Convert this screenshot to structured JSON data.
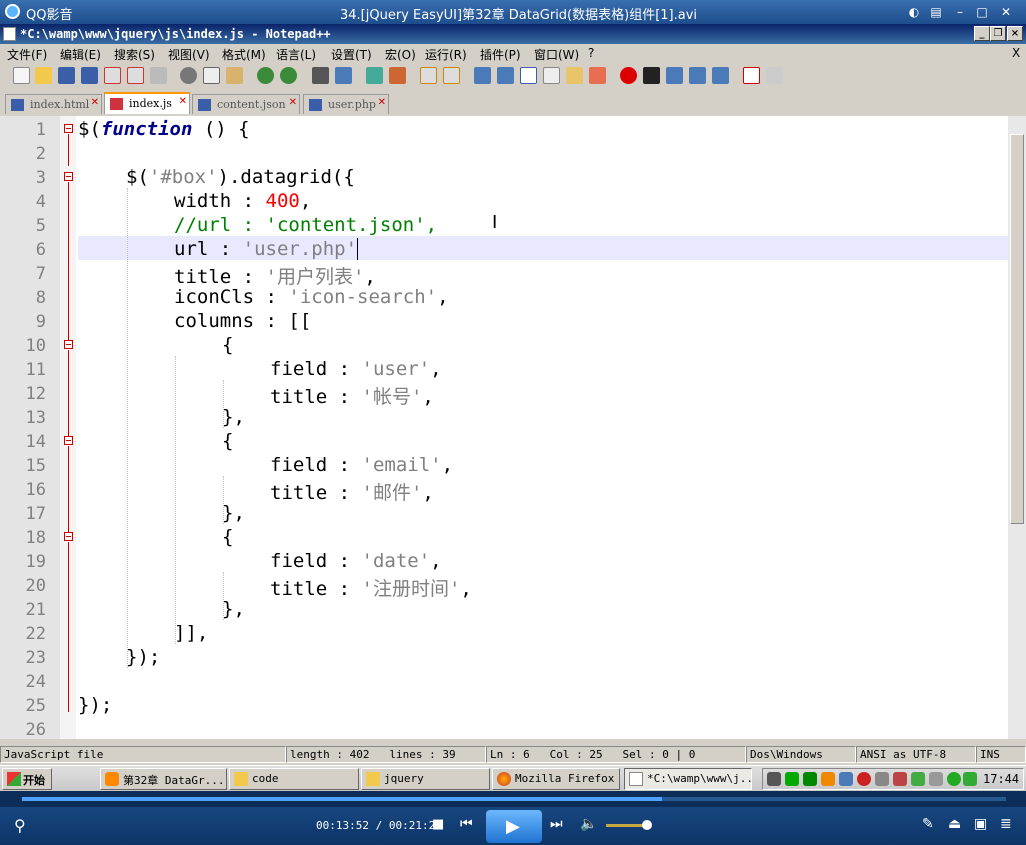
{
  "player": {
    "app_name": "QQ影音",
    "video_title": "34.[jQuery EasyUI]第32章 DataGrid(数据表格)组件[1].avi",
    "time_current": "00:13:52",
    "time_total": "00:21:21",
    "time_display": "00:13:52 / 00:21:21",
    "progress": 0.65,
    "volume": 0.6
  },
  "editor_window": {
    "title": "*C:\\wamp\\www\\jquery\\js\\index.js - Notepad++",
    "menu": [
      "文件(F)",
      "编辑(E)",
      "搜索(S)",
      "视图(V)",
      "格式(M)",
      "语言(L)",
      "设置(T)",
      "宏(O)",
      "运行(R)",
      "插件(P)",
      "窗口(W)",
      "?"
    ],
    "close_x": "X",
    "tabs": [
      {
        "label": "index.html",
        "active": false
      },
      {
        "label": "index.js",
        "active": true
      },
      {
        "label": "content.json",
        "active": false
      },
      {
        "label": "user.php",
        "active": false
      }
    ],
    "lines": [
      {
        "n": "1"
      },
      {
        "n": "2"
      },
      {
        "n": "3"
      },
      {
        "n": "4"
      },
      {
        "n": "5"
      },
      {
        "n": "6"
      },
      {
        "n": "7"
      },
      {
        "n": "8"
      },
      {
        "n": "9"
      },
      {
        "n": "10"
      },
      {
        "n": "11"
      },
      {
        "n": "12"
      },
      {
        "n": "13"
      },
      {
        "n": "14"
      },
      {
        "n": "15"
      },
      {
        "n": "16"
      },
      {
        "n": "17"
      },
      {
        "n": "18"
      },
      {
        "n": "19"
      },
      {
        "n": "20"
      },
      {
        "n": "21"
      },
      {
        "n": "22"
      },
      {
        "n": "23"
      },
      {
        "n": "24"
      },
      {
        "n": "25"
      },
      {
        "n": "26"
      }
    ],
    "code": {
      "l1_a": "$(",
      "l1_kw": "function",
      "l1_b": " () {",
      "l3_a": "$(",
      "l3_s": "'#box'",
      "l3_b": ").datagrid({",
      "l4_a": "width : ",
      "l4_n": "400",
      "l4_b": ",",
      "l5_c": "//url : 'content.json',",
      "l6_a": "url : ",
      "l6_s": "'user.php'",
      "l7_a": "title : ",
      "l7_s": "'用户列表'",
      "l7_b": ",",
      "l8_a": "iconCls : ",
      "l8_s": "'icon-search'",
      "l8_b": ",",
      "l9": "columns : [[",
      "l10": "{",
      "l11_a": "field : ",
      "l11_s": "'user'",
      "l11_b": ",",
      "l12_a": "title : ",
      "l12_s": "'帐号'",
      "l12_b": ",",
      "l13": "},",
      "l14": "{",
      "l15_a": "field : ",
      "l15_s": "'email'",
      "l15_b": ",",
      "l16_a": "title : ",
      "l16_s": "'邮件'",
      "l16_b": ",",
      "l17": "},",
      "l18": "{",
      "l19_a": "field : ",
      "l19_s": "'date'",
      "l19_b": ",",
      "l20_a": "title : ",
      "l20_s": "'注册时间'",
      "l20_b": ",",
      "l21": "},",
      "l22": "]],",
      "l23": "});",
      "l25": "});"
    },
    "status": {
      "file_type": "JavaScript file",
      "length": "length : 402",
      "lines": "lines : 39",
      "ln": "Ln : 6",
      "col": "Col : 25",
      "sel": "Sel : 0 | 0",
      "eol": "Dos\\Windows",
      "encoding": "ANSI as UTF-8",
      "mode": "INS"
    }
  },
  "taskbar": {
    "start": "开始",
    "tasks": [
      "第32章 DataGr...",
      "code",
      "jquery",
      "Mozilla Firefox",
      "*C:\\wamp\\www\\j..."
    ],
    "clock": "17:44"
  },
  "colors": {
    "keyword": "#00008b",
    "string": "#808080",
    "number": "#ff0000",
    "comment": "#008000",
    "current_line": "#e8e8ff",
    "player_bg": "#0d3466",
    "active_tab_accent": "#ff9900"
  }
}
